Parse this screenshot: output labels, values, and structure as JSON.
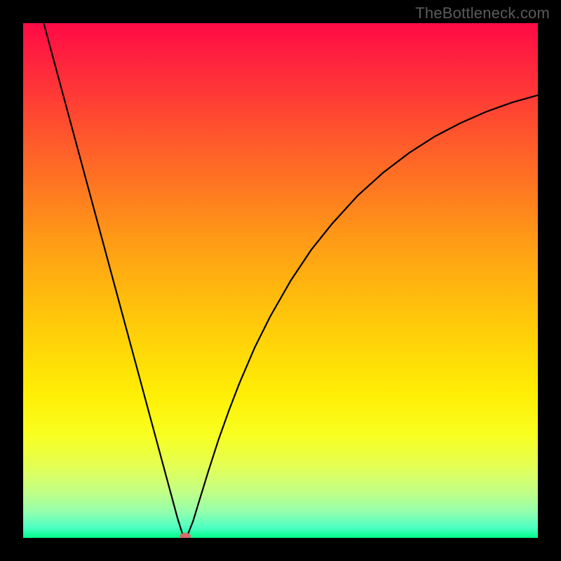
{
  "watermark": "TheBottleneck.com",
  "chart_data": {
    "type": "line",
    "title": "",
    "xlabel": "",
    "ylabel": "",
    "xlim": [
      0,
      100
    ],
    "ylim": [
      0,
      100
    ],
    "grid": false,
    "series": [
      {
        "name": "curve",
        "x": [
          4,
          6,
          8,
          10,
          12,
          14,
          16,
          18,
          20,
          22,
          24,
          26,
          28,
          29,
          30,
          31,
          31.5,
          32,
          33,
          34,
          36,
          38,
          40,
          42,
          45,
          48,
          52,
          56,
          60,
          65,
          70,
          75,
          80,
          85,
          90,
          95,
          100
        ],
        "y": [
          100,
          92.6,
          85.2,
          77.8,
          70.4,
          63.0,
          55.6,
          48.2,
          40.8,
          33.4,
          26.0,
          18.6,
          11.2,
          7.5,
          3.8,
          0.6,
          0.1,
          0.7,
          3.2,
          6.5,
          13.0,
          19.2,
          24.8,
          30.0,
          37.0,
          43.0,
          50.0,
          56.0,
          61.0,
          66.5,
          71.0,
          74.8,
          78.0,
          80.6,
          82.8,
          84.6,
          86.0
        ]
      }
    ],
    "marker": {
      "x": 31.5,
      "y": 0.3,
      "color": "#d46a6a"
    }
  },
  "colors": {
    "frame": "#000000",
    "curve": "#000000",
    "marker": "#d46a6a"
  }
}
